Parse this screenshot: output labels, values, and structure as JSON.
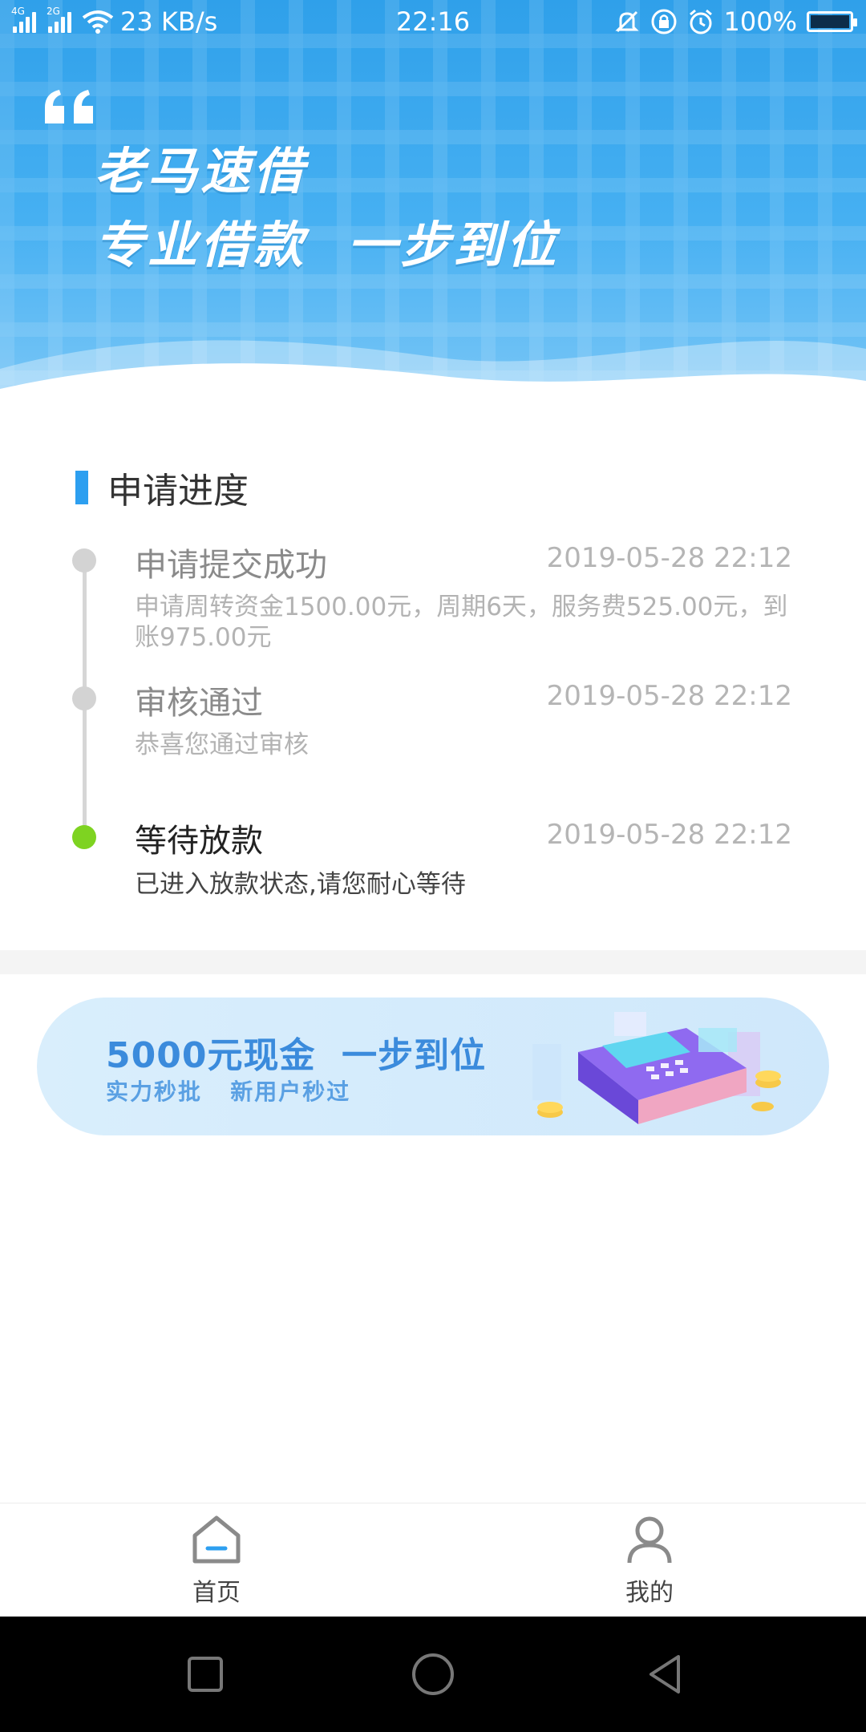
{
  "status_bar": {
    "net_speed": "23 KB/s",
    "time": "22:16",
    "battery": "100%",
    "sig1": "4G",
    "sig2": "2G"
  },
  "banner": {
    "line1": "老马速借",
    "line2": "专业借款  一步到位"
  },
  "progress": {
    "title": "申请进度",
    "steps": [
      {
        "title": "申请提交成功",
        "date": "2019-05-28 22:12",
        "desc": "申请周转资金1500.00元，周期6天，服务费525.00元，到账975.00元"
      },
      {
        "title": "审核通过",
        "date": "2019-05-28 22:12",
        "desc": "恭喜您通过审核"
      },
      {
        "title": "等待放款",
        "date": "2019-05-28 22:12",
        "desc": "已进入放款状态,请您耐心等待"
      }
    ]
  },
  "promo": {
    "title": "5000元现金  一步到位",
    "subtitle": "实力秒批   新用户秒过"
  },
  "bottom_nav": {
    "items": [
      {
        "label": "首页",
        "icon": "home-icon"
      },
      {
        "label": "我的",
        "icon": "user-icon"
      }
    ]
  },
  "colors": {
    "accent": "#2d9ff0",
    "active_node": "#7ed321",
    "banner_top": "#2fa0ea"
  }
}
